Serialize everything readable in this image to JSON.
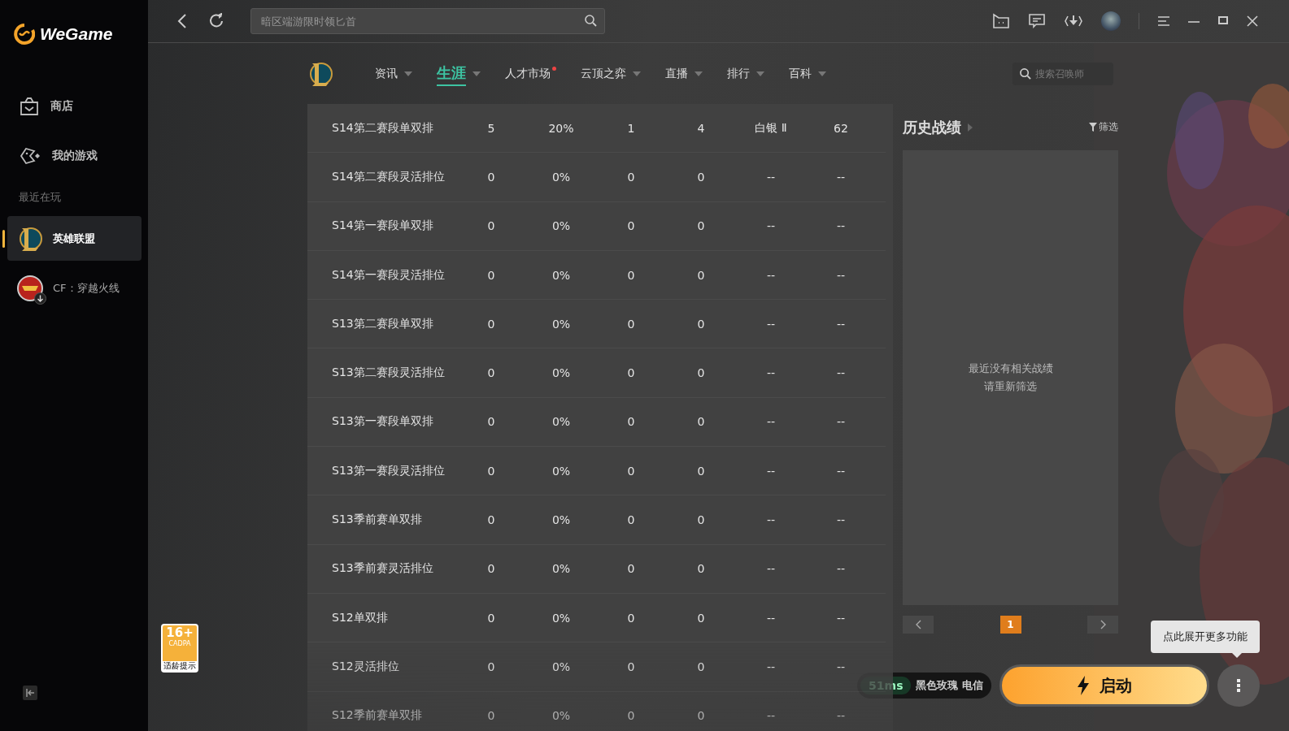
{
  "sidebar": {
    "logo": "WeGame",
    "items": [
      {
        "label": "商店",
        "kind": "store",
        "selected": false
      },
      {
        "label": "我的游戏",
        "kind": "games",
        "selected": false
      }
    ],
    "section_title": "最近在玩",
    "recent": [
      {
        "label": "英雄联盟",
        "kind": "lol",
        "selected": true,
        "downloading": false
      },
      {
        "label": "CF：穿越火线",
        "kind": "cf",
        "selected": false,
        "downloading": true
      }
    ]
  },
  "topbar": {
    "search": {
      "placeholder": "暗区端游限时领匕首"
    }
  },
  "nav": {
    "tabs": [
      {
        "label": "资讯",
        "selected": false,
        "dropdown": true,
        "notice": false
      },
      {
        "label": "生涯",
        "selected": true,
        "dropdown": true,
        "notice": false
      },
      {
        "label": "人才市场",
        "selected": false,
        "dropdown": false,
        "notice": true
      },
      {
        "label": "云顶之弈",
        "selected": false,
        "dropdown": true,
        "notice": false
      },
      {
        "label": "直播",
        "selected": false,
        "dropdown": true,
        "notice": false
      },
      {
        "label": "排行",
        "selected": false,
        "dropdown": true,
        "notice": false
      },
      {
        "label": "百科",
        "selected": false,
        "dropdown": true,
        "notice": false
      }
    ],
    "summoner_search": {
      "placeholder": "搜索召唤师"
    }
  },
  "table": {
    "rows": [
      {
        "name": "S14第二赛段单双排",
        "cells": [
          "5",
          "20%",
          "1",
          "4",
          "白银 Ⅱ",
          "62"
        ]
      },
      {
        "name": "S14第二赛段灵活排位",
        "cells": [
          "0",
          "0%",
          "0",
          "0",
          "--",
          "--"
        ]
      },
      {
        "name": "S14第一赛段单双排",
        "cells": [
          "0",
          "0%",
          "0",
          "0",
          "--",
          "--"
        ]
      },
      {
        "name": "S14第一赛段灵活排位",
        "cells": [
          "0",
          "0%",
          "0",
          "0",
          "--",
          "--"
        ]
      },
      {
        "name": "S13第二赛段单双排",
        "cells": [
          "0",
          "0%",
          "0",
          "0",
          "--",
          "--"
        ]
      },
      {
        "name": "S13第二赛段灵活排位",
        "cells": [
          "0",
          "0%",
          "0",
          "0",
          "--",
          "--"
        ]
      },
      {
        "name": "S13第一赛段单双排",
        "cells": [
          "0",
          "0%",
          "0",
          "0",
          "--",
          "--"
        ]
      },
      {
        "name": "S13第一赛段灵活排位",
        "cells": [
          "0",
          "0%",
          "0",
          "0",
          "--",
          "--"
        ]
      },
      {
        "name": "S13季前赛单双排",
        "cells": [
          "0",
          "0%",
          "0",
          "0",
          "--",
          "--"
        ]
      },
      {
        "name": "S13季前赛灵活排位",
        "cells": [
          "0",
          "0%",
          "0",
          "0",
          "--",
          "--"
        ]
      },
      {
        "name": "S12单双排",
        "cells": [
          "0",
          "0%",
          "0",
          "0",
          "--",
          "--"
        ]
      },
      {
        "name": "S12灵活排位",
        "cells": [
          "0",
          "0%",
          "0",
          "0",
          "--",
          "--"
        ]
      },
      {
        "name": "S12季前赛单双排",
        "cells": [
          "0",
          "0%",
          "0",
          "0",
          "--",
          "--"
        ]
      }
    ]
  },
  "history": {
    "title": "历史战绩",
    "filter": "筛选",
    "empty_lines": [
      "最近没有相关战绩",
      "请重新筛选"
    ],
    "pages": [
      {
        "label": "1",
        "selected": true
      }
    ]
  },
  "age_badge": {
    "rating": "16+",
    "org": "CADPA",
    "caption": "适龄提示"
  },
  "launch": {
    "ping": "51ms",
    "server": "黑色玫瑰 电信",
    "button": "启动",
    "tooltip": "点此展开更多功能"
  }
}
